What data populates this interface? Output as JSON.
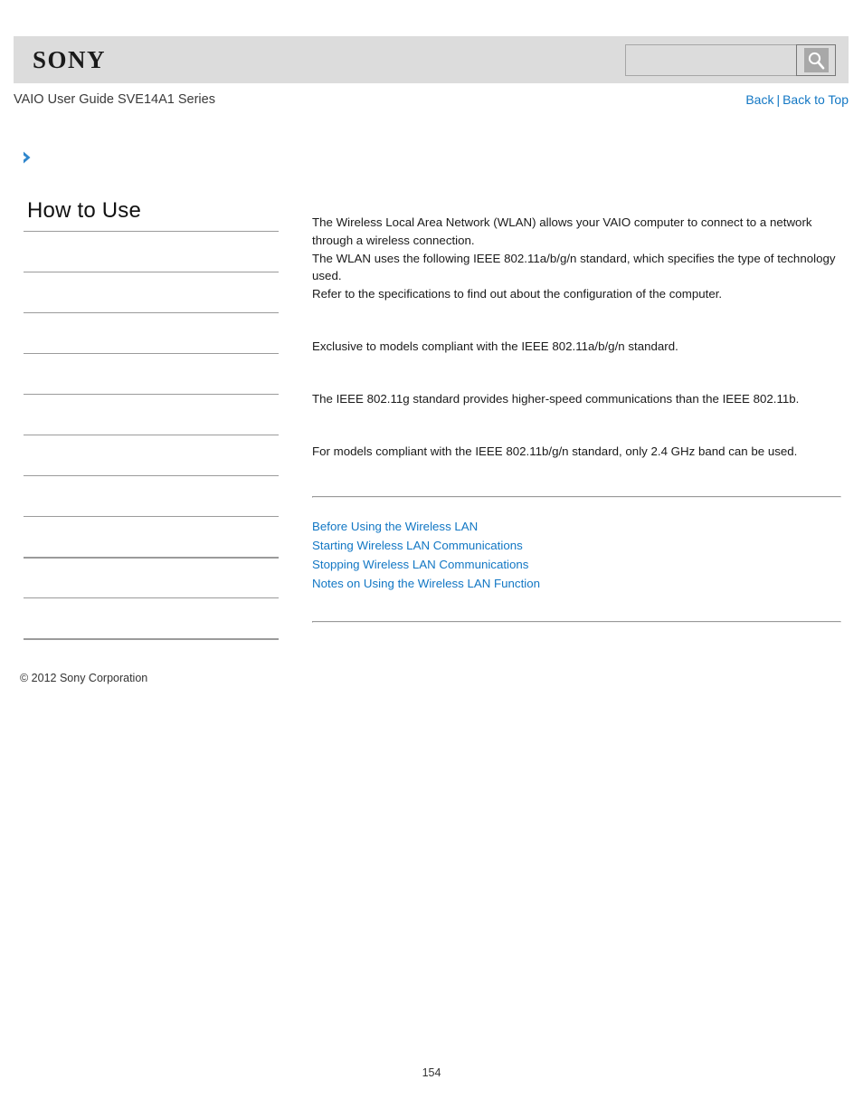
{
  "header": {
    "logo_text": "SONY",
    "search": {
      "value": "",
      "placeholder": "",
      "button_icon": "search-icon"
    }
  },
  "title_bar": {
    "guide_title": "VAIO User Guide SVE14A1 Series",
    "back_label": "Back",
    "separator": "|",
    "back_to_top_label": "Back to Top"
  },
  "breadcrumb": {
    "icon": "chevron-right-icon",
    "text": ""
  },
  "sidebar": {
    "heading": "How to Use",
    "items": [
      {
        "label": ""
      },
      {
        "label": ""
      },
      {
        "label": ""
      },
      {
        "label": ""
      },
      {
        "label": ""
      },
      {
        "label": ""
      },
      {
        "label": ""
      },
      {
        "label": ""
      },
      {
        "label": ""
      },
      {
        "label": ""
      }
    ]
  },
  "content": {
    "paragraph_1": [
      "The Wireless Local Area Network (WLAN) allows your VAIO computer to connect to a network through a wireless connection.",
      "The WLAN uses the following IEEE 802.11a/b/g/n standard, which specifies the type of technology used.",
      "Refer to the specifications to find out about the configuration of the computer."
    ],
    "paragraph_1_line_1": "The Wireless Local Area Network (WLAN) allows your VAIO computer to connect to a network through a wireless connection.",
    "paragraph_1_line_2": "The WLAN uses the following IEEE 802.11a/b/g/n standard, which specifies the type of technology used.",
    "paragraph_1_line_3": "Refer to the specifications to find out about the configuration of the computer.",
    "paragraph_2": "Exclusive to models compliant with the IEEE 802.11a/b/g/n standard.",
    "paragraph_3": "The IEEE 802.11g standard provides higher-speed communications than the IEEE 802.11b.",
    "paragraph_4": "For models compliant with the IEEE 802.11b/g/n standard, only 2.4 GHz band can be used.",
    "related_links": [
      "Before Using the Wireless LAN",
      "Starting Wireless LAN Communications",
      "Stopping Wireless LAN Communications",
      "Notes on Using the Wireless LAN Function"
    ]
  },
  "footer": {
    "copyright": "© 2012 Sony Corporation",
    "page_number": "154"
  },
  "colors": {
    "link": "#1277c4",
    "header_band": "#dcdcdc",
    "rule": "#c9c9c9",
    "sidebar_rule": "#9b9b9b"
  }
}
